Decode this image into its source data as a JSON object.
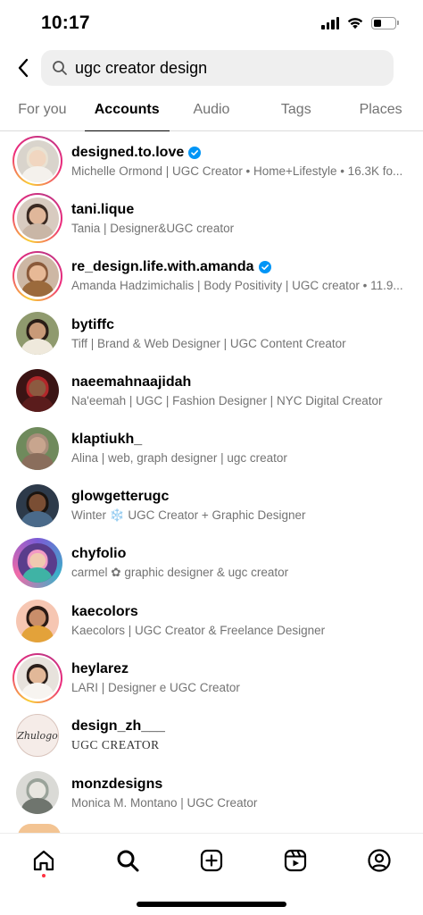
{
  "status_bar": {
    "time": "10:17",
    "icons": [
      "signal-icon",
      "wifi-icon",
      "battery-icon"
    ]
  },
  "search": {
    "query": "ugc creator design",
    "back_icon": "chevron-left-icon",
    "search_icon": "search-icon"
  },
  "tabs": [
    {
      "label": "For you",
      "active": false
    },
    {
      "label": "Accounts",
      "active": true
    },
    {
      "label": "Audio",
      "active": false
    },
    {
      "label": "Tags",
      "active": false
    },
    {
      "label": "Places",
      "active": false
    }
  ],
  "accounts": [
    {
      "username": "designed.to.love",
      "subtitle": "Michelle Ormond | UGC Creator • Home+Lifestyle • 16.3K fo...",
      "verified": true,
      "story": true
    },
    {
      "username": "tani.lique",
      "subtitle": "Tania | Designer&UGC creator",
      "verified": false,
      "story": true
    },
    {
      "username": "re_design.life.with.amanda",
      "subtitle": "Amanda Hadzimichalis | Body Positivity | UGC creator • 11.9...",
      "verified": true,
      "story": true
    },
    {
      "username": "bytiffc",
      "subtitle": "Tiff | Brand & Web Designer | UGC Content Creator",
      "verified": false,
      "story": false
    },
    {
      "username": "naeemahnaajidah",
      "subtitle": "Na'eemah | UGC | Fashion Designer | NYC Digital Creator",
      "verified": false,
      "story": false
    },
    {
      "username": "klaptiukh_",
      "subtitle": "Alina | web, graph designer | ugc creator",
      "verified": false,
      "story": false
    },
    {
      "username": "glowgetterugc",
      "subtitle": "Winter ❄️ UGC Creator +  Graphic Designer",
      "verified": false,
      "story": false
    },
    {
      "username": "chyfolio",
      "subtitle": "carmel ✿ graphic designer & ugc creator",
      "verified": false,
      "story": false
    },
    {
      "username": "kaecolors",
      "subtitle": "Kaecolors | UGC Creator & Freelance Designer",
      "verified": false,
      "story": false
    },
    {
      "username": "heylarez",
      "subtitle": "LARI | Designer e UGC Creator",
      "verified": false,
      "story": true
    },
    {
      "username": "design_zh___",
      "subtitle": "UGC CREATOR",
      "verified": false,
      "story": false
    },
    {
      "username": "monzdesigns",
      "subtitle": "Monica M. Montano | UGC Creator",
      "verified": false,
      "story": false
    }
  ],
  "avatar_logo_text": "Zhulogo",
  "bottom_nav": [
    {
      "name": "home-icon",
      "has_notification": true
    },
    {
      "name": "search-icon",
      "has_notification": false
    },
    {
      "name": "create-post-icon",
      "has_notification": false
    },
    {
      "name": "reels-icon",
      "has_notification": false
    },
    {
      "name": "profile-icon",
      "has_notification": false
    }
  ],
  "colors": {
    "verified_blue": "#0095f6",
    "story_ring": [
      "#f9ce34",
      "#ee2a7b",
      "#c13584"
    ],
    "secondary_text": "#737373",
    "notification_dot": "#ff3040"
  }
}
